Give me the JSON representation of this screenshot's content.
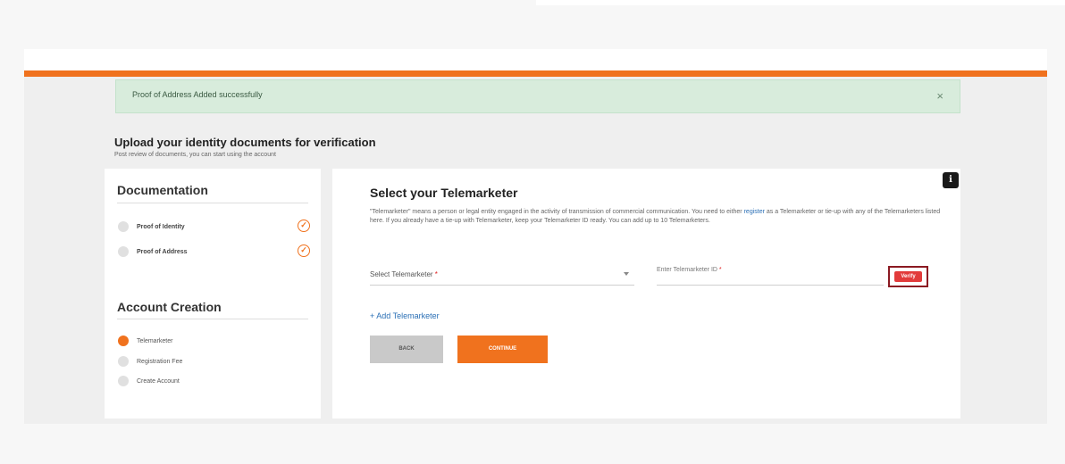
{
  "alert": {
    "message": "Proof of Address Added successfully",
    "close_glyph": "×"
  },
  "page": {
    "heading": "Upload your identity documents for verification",
    "subheading": "Post review of documents, you can start using the account"
  },
  "documentation": {
    "title": "Documentation",
    "items": [
      {
        "label": "Proof of Identity",
        "completed": true
      },
      {
        "label": "Proof of Address",
        "completed": true
      }
    ]
  },
  "account_creation": {
    "title": "Account Creation",
    "steps": [
      {
        "label": "Telemarketer",
        "active": true
      },
      {
        "label": "Registration Fee",
        "active": false
      },
      {
        "label": "Create Account",
        "active": false
      }
    ]
  },
  "telemarketer": {
    "title": "Select your Telemarketer",
    "desc_part1": "\"Telemarketer\" means a person or legal entity engaged in the activity of transmission of commercial communication. You need to either",
    "desc_link": "register",
    "desc_part2": " as a Telemarketer or tie-up with any of the Telemarketers listed here. If you already have a tie-up with Telemarketer, keep your Telemarketer ID ready. You can add up to 10 Telemarketers.",
    "select_label": "Select Telemarketer",
    "required_mark": "*",
    "id_label": "Enter Telemarketer ID",
    "verify_label": "Verify",
    "add_link": "+ Add Telemarketer",
    "back_label": "BACK",
    "continue_label": "CONTINUE"
  },
  "icons": {
    "info": "info-icon",
    "check": "check-circle-icon",
    "close": "close-icon",
    "dropdown": "chevron-down-icon"
  },
  "colors": {
    "accent": "#f0721e",
    "success_bg": "#d8ecdc",
    "verify": "#e23b3b",
    "link": "#2a6fb5"
  }
}
